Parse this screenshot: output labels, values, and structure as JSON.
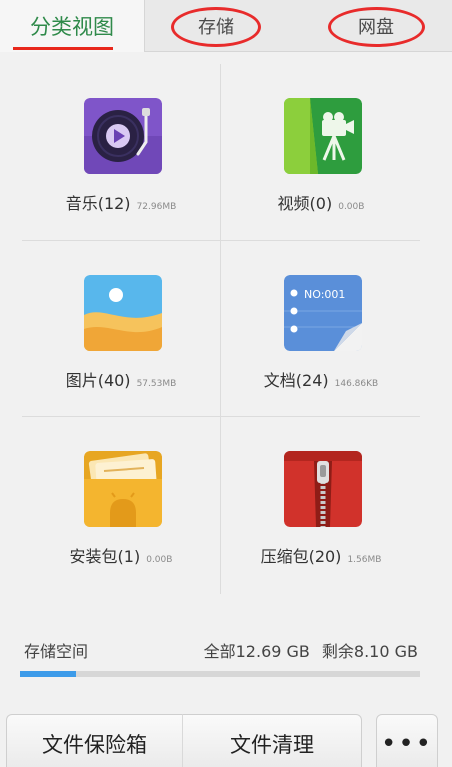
{
  "tabs": [
    {
      "label": "分类视图",
      "active": true
    },
    {
      "label": "存储",
      "active": false
    },
    {
      "label": "网盘",
      "active": false
    }
  ],
  "categories": [
    {
      "name": "音乐(12)",
      "size": "72.96MB",
      "icon": "music-icon"
    },
    {
      "name": "视频(0)",
      "size": "0.00B",
      "icon": "video-icon"
    },
    {
      "name": "图片(40)",
      "size": "57.53MB",
      "icon": "image-icon"
    },
    {
      "name": "文档(24)",
      "size": "146.86KB",
      "icon": "document-icon"
    },
    {
      "name": "安装包(1)",
      "size": "0.00B",
      "icon": "apk-icon"
    },
    {
      "name": "压缩包(20)",
      "size": "1.56MB",
      "icon": "archive-icon"
    }
  ],
  "doc_icon_text": "NO:001",
  "storage": {
    "label": "存储空间",
    "total": "全部12.69 GB",
    "free": "剩余8.10 GB",
    "used_fraction": 0.14
  },
  "bottom": {
    "vault": "文件保险箱",
    "clean": "文件清理",
    "more": "•••"
  },
  "colors": {
    "active_tab": "#2f8a4a",
    "underline": "#e8281c",
    "annotation_circle": "#e82b2b",
    "progress_fill": "#3d9be9"
  }
}
